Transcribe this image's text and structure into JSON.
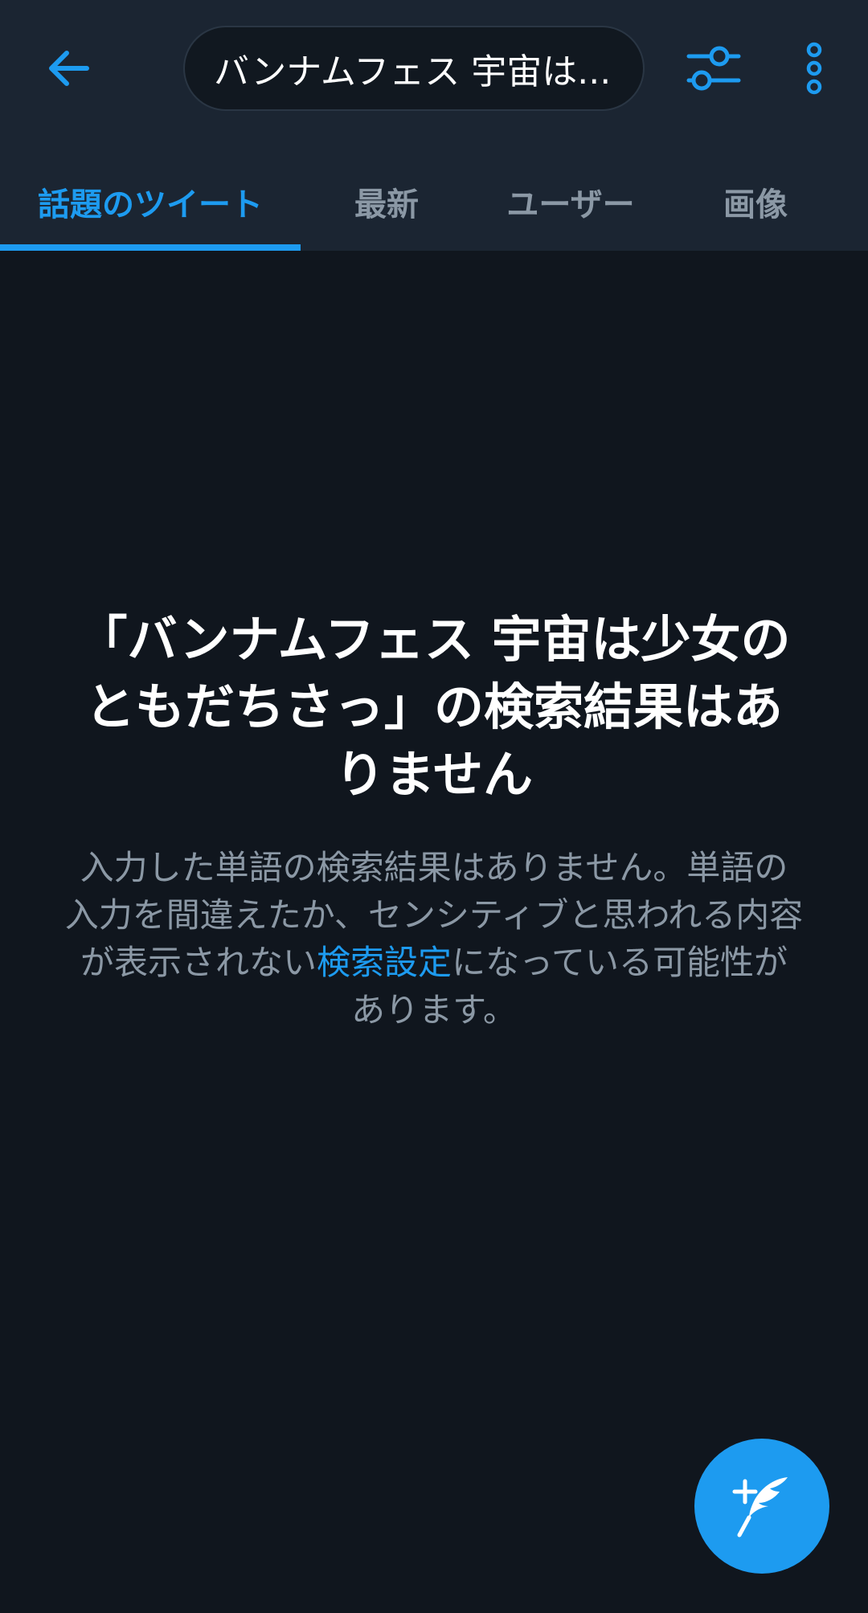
{
  "colors": {
    "accent": "#1d9bf0",
    "header_bg": "#1b2532",
    "page_bg": "#10161e",
    "muted_text": "#8b98a5"
  },
  "topbar": {
    "back_icon": "arrow-left-icon",
    "search_query": "バンナムフェス 宇宙は...",
    "filter_icon": "sliders-icon",
    "more_icon": "vertical-dots-icon"
  },
  "tabs": [
    {
      "label": "話題のツイート",
      "active": true
    },
    {
      "label": "最新",
      "active": false
    },
    {
      "label": "ユーザー",
      "active": false
    },
    {
      "label": "画像",
      "active": false
    }
  ],
  "empty_state": {
    "title": "「バンナムフェス 宇宙は少女のともだちさっ」の検索結果はありません",
    "body_before_link": "入力した単語の検索結果はありません。単語の入力を間違えたか、センシティブと思われる内容が表示されない",
    "link_text": "検索設定",
    "body_after_link": "になっている可能性があります。"
  },
  "fab": {
    "icon": "compose-tweet-icon"
  }
}
